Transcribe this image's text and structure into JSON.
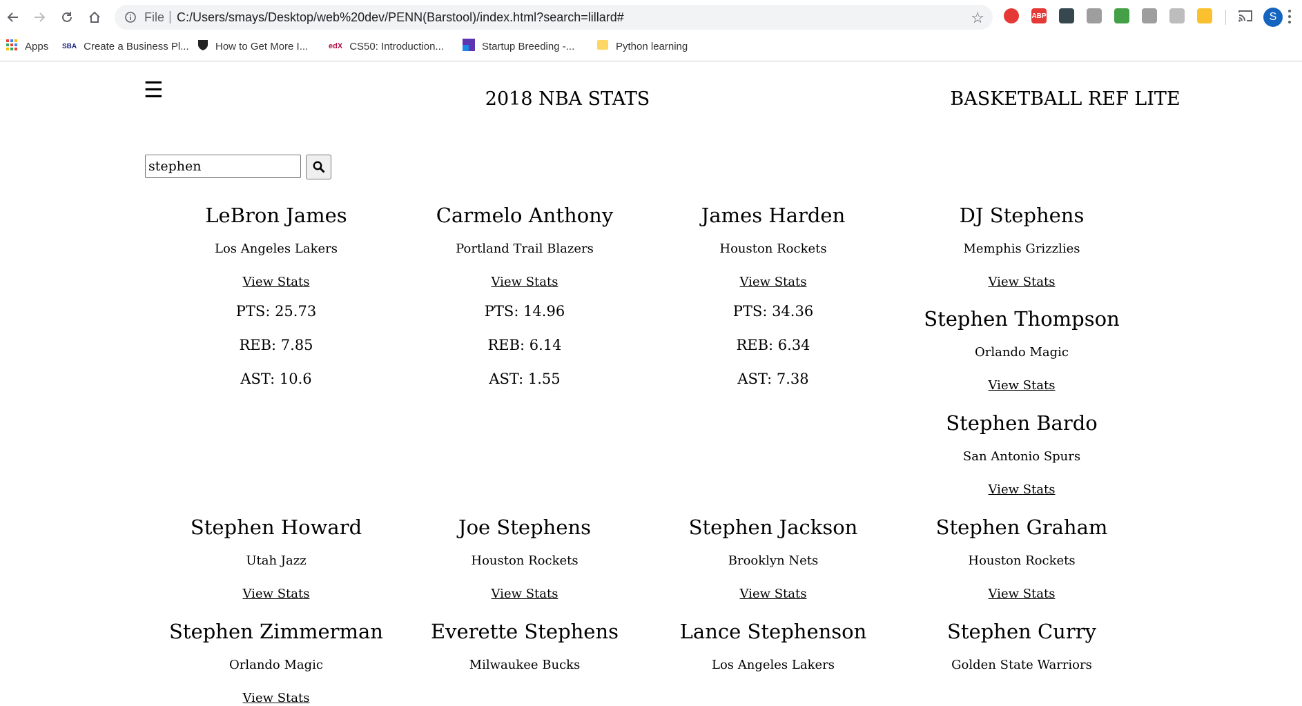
{
  "browser": {
    "file_label": "File",
    "url": "C:/Users/smays/Desktop/web%20dev/PENN(Barstool)/index.html?search=lillard#",
    "profile_initial": "S",
    "bookmarks": [
      {
        "label": "Apps"
      },
      {
        "label": "Create a Business Pl..."
      },
      {
        "label": "How to Get More I..."
      },
      {
        "label": "CS50: Introduction..."
      },
      {
        "label": "Startup Breeding -..."
      },
      {
        "label": "Python learning"
      }
    ],
    "extensions": [
      {
        "name": "adblock-stop-icon",
        "color": "#e53935"
      },
      {
        "name": "abp-icon",
        "color": "#e53935",
        "text": "ABP"
      },
      {
        "name": "dark-ext-icon",
        "color": "#37474f"
      },
      {
        "name": "check-ext-icon",
        "color": "#9e9e9e"
      },
      {
        "name": "landscape-ext-icon",
        "color": "#43a047"
      },
      {
        "name": "camera-icon",
        "color": "#9e9e9e"
      },
      {
        "name": "script-ext-icon",
        "color": "#bdbdbd"
      },
      {
        "name": "color-wheel-icon",
        "color": "#fbc02d"
      }
    ]
  },
  "page": {
    "menu_glyph": "☰",
    "title": "2018 NBA STATS",
    "brand": "BASKETBALL REF LITE",
    "search": {
      "value": "stephen"
    }
  },
  "cards": [
    {
      "name": "LeBron James",
      "team": "Los Angeles Lakers",
      "link": "View Stats",
      "stats": [
        "PTS: 25.73",
        "REB: 7.85",
        "AST: 10.6"
      ]
    },
    {
      "name": "Carmelo Anthony",
      "team": "Portland Trail Blazers",
      "link": "View Stats",
      "stats": [
        "PTS: 14.96",
        "REB: 6.14",
        "AST: 1.55"
      ]
    },
    {
      "name": "James Harden",
      "team": "Houston Rockets",
      "link": "View Stats",
      "stats": [
        "PTS: 34.36",
        "REB: 6.34",
        "AST: 7.38"
      ]
    },
    {
      "name": "DJ Stephens",
      "team": "Memphis Grizzlies",
      "link": "View Stats",
      "stats": []
    },
    {
      "name": "Stephen Thompson",
      "team": "Orlando Magic",
      "link": "View Stats",
      "stats": []
    },
    {
      "name": "Stephen Bardo",
      "team": "San Antonio Spurs",
      "link": "View Stats",
      "stats": []
    },
    {
      "name": "Stephen Howard",
      "team": "Utah Jazz",
      "link": "View Stats",
      "stats": []
    },
    {
      "name": "Joe Stephens",
      "team": "Houston Rockets",
      "link": "View Stats",
      "stats": []
    },
    {
      "name": "Stephen Jackson",
      "team": "Brooklyn Nets",
      "link": "View Stats",
      "stats": []
    },
    {
      "name": "Stephen Graham",
      "team": "Houston Rockets",
      "link": "View Stats",
      "stats": []
    },
    {
      "name": "Stephen Zimmerman",
      "team": "Orlando Magic",
      "link": "View Stats",
      "stats": []
    },
    {
      "name": "Everette Stephens",
      "team": "Milwaukee Bucks",
      "link": "",
      "stats": []
    },
    {
      "name": "Lance Stephenson",
      "team": "Los Angeles Lakers",
      "link": "",
      "stats": []
    },
    {
      "name": "Stephen Curry",
      "team": "Golden State Warriors",
      "link": "",
      "stats": []
    }
  ]
}
